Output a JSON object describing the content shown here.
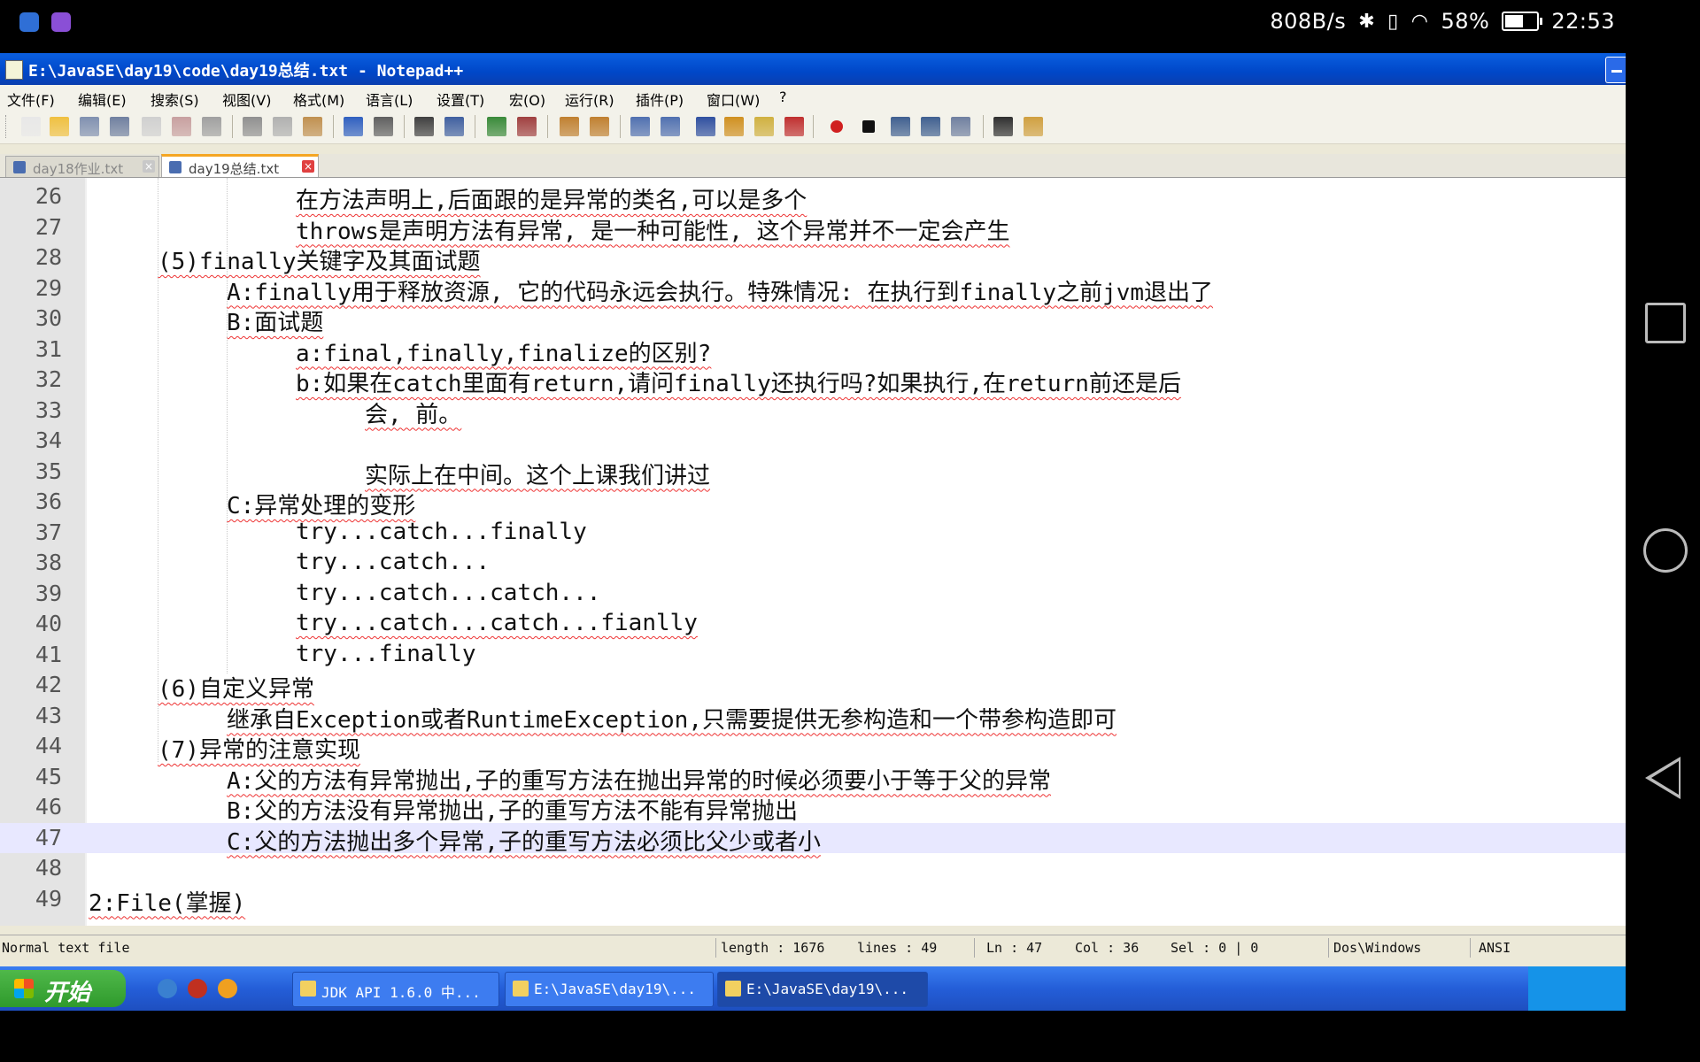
{
  "android_status": {
    "net_speed": "808B/s",
    "battery_pct": "58%",
    "time": "22:53",
    "battery_level": 0.58
  },
  "window": {
    "title": "E:\\JavaSE\\day19\\code\\day19总结.txt - Notepad++"
  },
  "menu": [
    "文件(F)",
    "编辑(E)",
    "搜索(S)",
    "视图(V)",
    "格式(M)",
    "语言(L)",
    "设置(T)",
    "宏(O)",
    "运行(R)",
    "插件(P)",
    "窗口(W)",
    "?"
  ],
  "tabs": [
    {
      "label": "day18作业.txt",
      "active": false
    },
    {
      "label": "day19总结.txt",
      "active": true
    }
  ],
  "editor": {
    "current_line": 47,
    "lines": [
      {
        "n": "26",
        "text": "\t\t\t在方法声明上,后面跟的是异常的类名,可以是多个"
      },
      {
        "n": "27",
        "text": "\t\t\tthrows是声明方法有异常, 是一种可能性, 这个异常并不一定会产生"
      },
      {
        "n": "28",
        "text": "\t(5)finally关键字及其面试题"
      },
      {
        "n": "29",
        "text": "\t\tA:finally用于释放资源, 它的代码永远会执行。特殊情况: 在执行到finally之前jvm退出了"
      },
      {
        "n": "30",
        "text": "\t\tB:面试题"
      },
      {
        "n": "31",
        "text": "\t\t\ta:final,finally,finalize的区别?"
      },
      {
        "n": "32",
        "text": "\t\t\tb:如果在catch里面有return,请问finally还执行吗?如果执行,在return前还是后"
      },
      {
        "n": "33",
        "text": "\t\t\t\t会, 前。"
      },
      {
        "n": "34",
        "text": ""
      },
      {
        "n": "35",
        "text": "\t\t\t\t实际上在中间。这个上课我们讲过"
      },
      {
        "n": "36",
        "text": "\t\tC:异常处理的变形"
      },
      {
        "n": "37",
        "text": "\t\t\ttry...catch...finally"
      },
      {
        "n": "38",
        "text": "\t\t\ttry...catch..."
      },
      {
        "n": "39",
        "text": "\t\t\ttry...catch...catch..."
      },
      {
        "n": "40",
        "text": "\t\t\ttry...catch...catch...fianlly"
      },
      {
        "n": "41",
        "text": "\t\t\ttry...finally"
      },
      {
        "n": "42",
        "text": "\t(6)自定义异常"
      },
      {
        "n": "43",
        "text": "\t\t继承自Exception或者RuntimeException,只需要提供无参构造和一个带参构造即可"
      },
      {
        "n": "44",
        "text": "\t(7)异常的注意实现"
      },
      {
        "n": "45",
        "text": "\t\tA:父的方法有异常抛出,子的重写方法在抛出异常的时候必须要小于等于父的异常"
      },
      {
        "n": "46",
        "text": "\t\tB:父的方法没有异常抛出,子的重写方法不能有异常抛出"
      },
      {
        "n": "47",
        "text": "\t\tC:父的方法抛出多个异常,子的重写方法必须比父少或者小"
      },
      {
        "n": "48",
        "text": ""
      },
      {
        "n": "49",
        "text": "2:File(掌握)"
      }
    ]
  },
  "statusbar": {
    "file_type": "Normal text file",
    "length": "length : 1676",
    "lines": "lines : 49",
    "ln": "Ln : 47",
    "col": "Col : 36",
    "sel": "Sel : 0 | 0",
    "eol": "Dos\\Windows",
    "encoding": "ANSI"
  },
  "taskbar": {
    "start_label": "开始",
    "tasks": [
      {
        "label": "JDK API 1.6.0 中...",
        "active": false
      },
      {
        "label": "E:\\JavaSE\\day19\\...",
        "active": false
      },
      {
        "label": "E:\\JavaSE\\day19\\...",
        "active": true
      }
    ]
  }
}
